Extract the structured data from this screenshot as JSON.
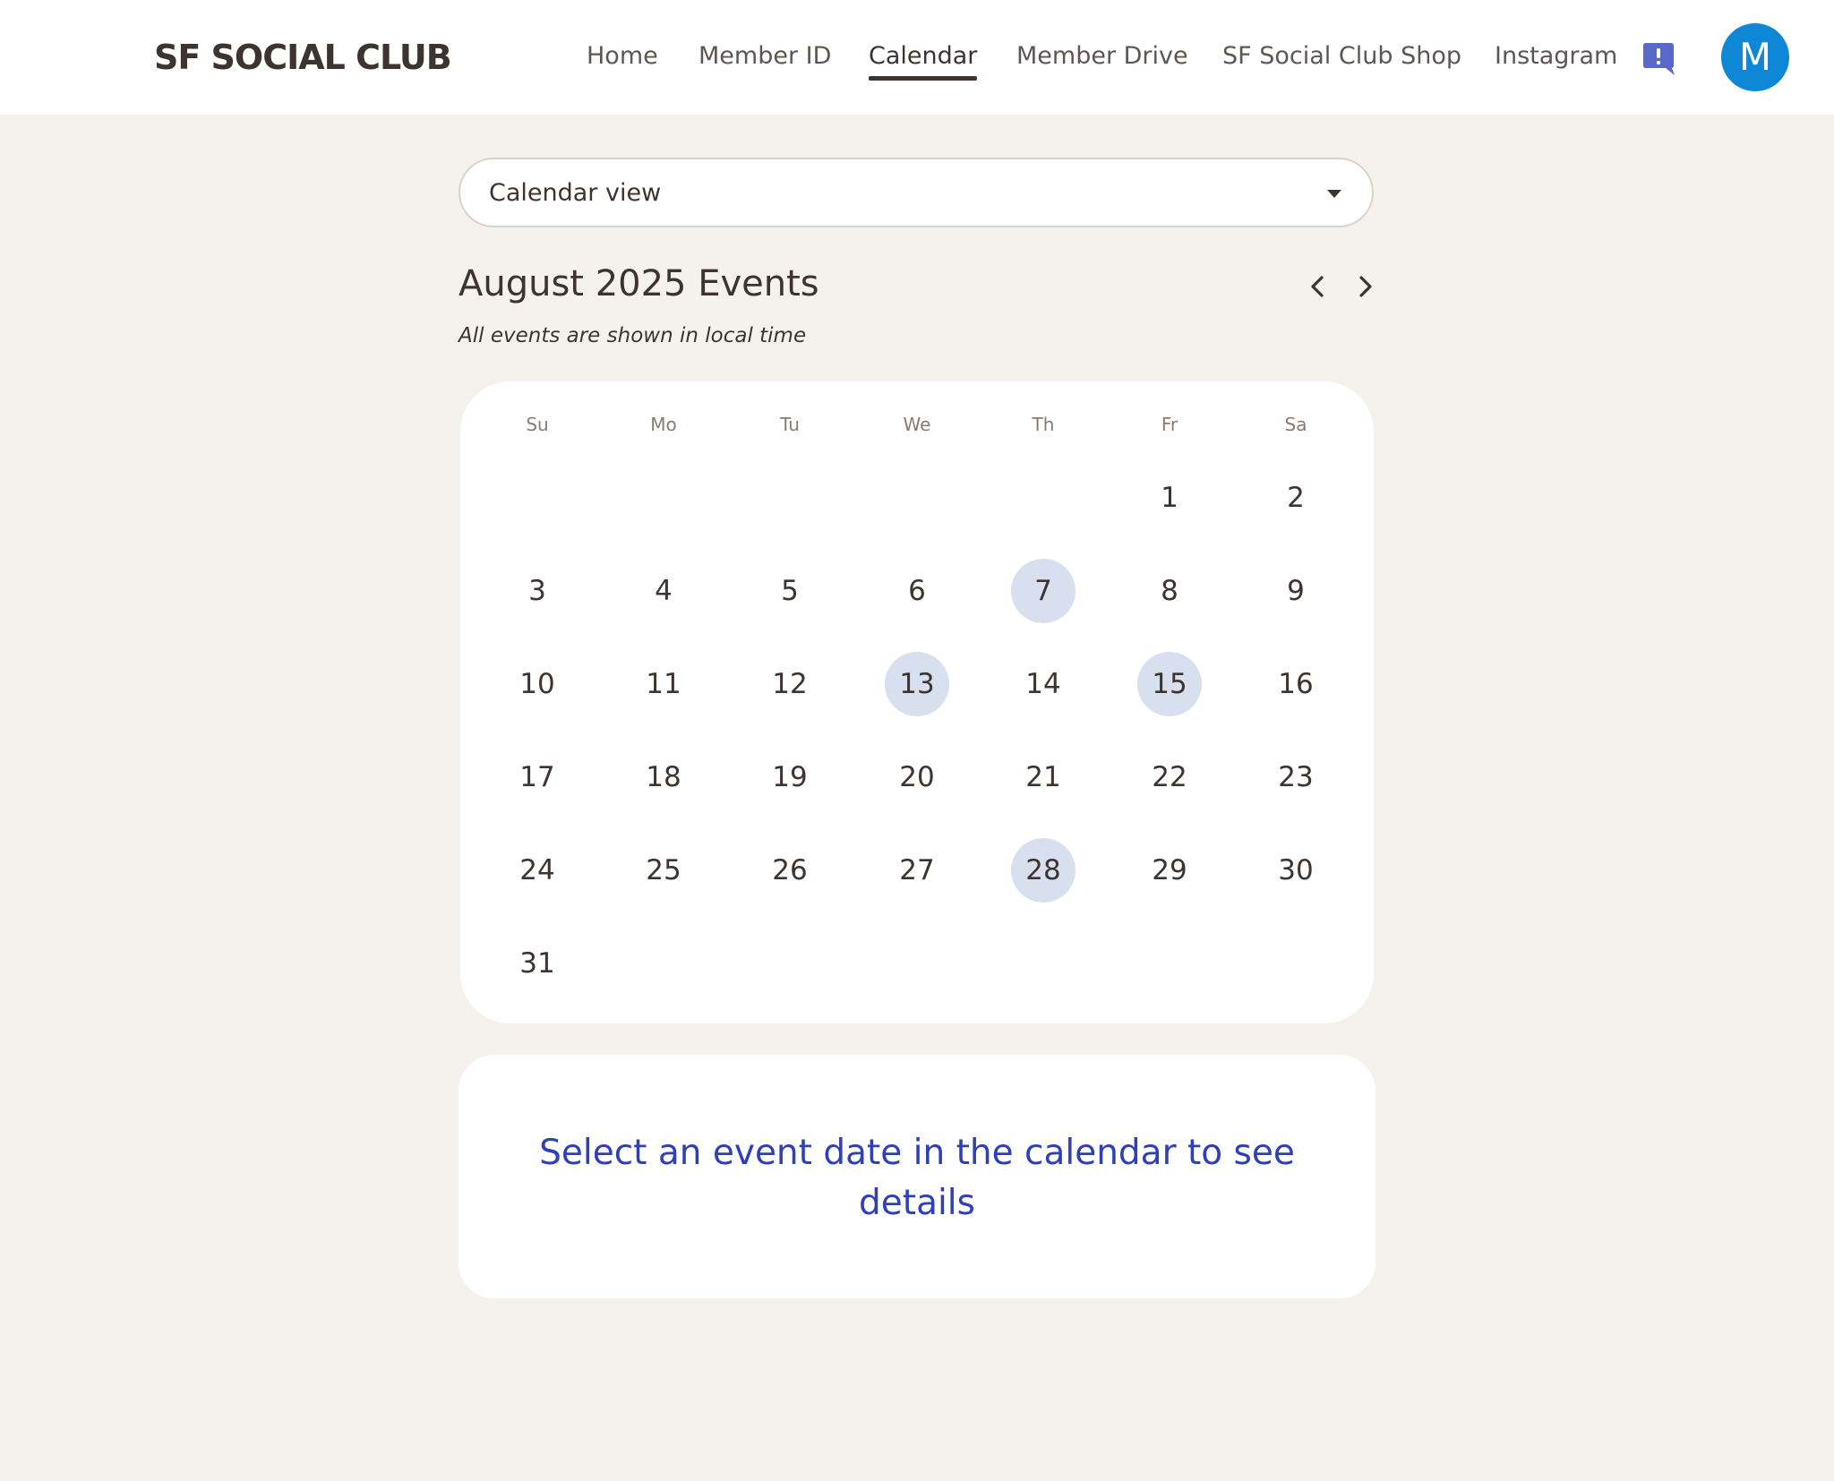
{
  "header": {
    "brand": "SF SOCIAL CLUB",
    "nav": [
      {
        "label": "Home",
        "active": false
      },
      {
        "label": "Member ID",
        "active": false
      },
      {
        "label": "Calendar",
        "active": true
      },
      {
        "label": "Member Drive",
        "active": false
      },
      {
        "label": "SF Social Club Shop",
        "active": false
      },
      {
        "label": "Instagram",
        "active": false
      }
    ],
    "feedback_icon": "feedback-exclamation-icon",
    "avatar_initial": "M",
    "avatar_color": "#0d87d6"
  },
  "view_select": {
    "value": "Calendar view"
  },
  "calendar": {
    "title": "August 2025 Events",
    "subtitle": "All events are shown in local time",
    "prev_icon": "chevron-left-icon",
    "next_icon": "chevron-right-icon",
    "weekdays": [
      "Su",
      "Mo",
      "Tu",
      "We",
      "Th",
      "Fr",
      "Sa"
    ],
    "days": [
      "1",
      "2",
      "3",
      "4",
      "5",
      "6",
      "7",
      "8",
      "9",
      "10",
      "11",
      "12",
      "13",
      "14",
      "15",
      "16",
      "17",
      "18",
      "19",
      "20",
      "21",
      "22",
      "23",
      "24",
      "25",
      "26",
      "27",
      "28",
      "29",
      "30",
      "31"
    ],
    "event_days": [
      "7",
      "13",
      "15",
      "28"
    ],
    "event_highlight_color": "#d8e0ef"
  },
  "details": {
    "message": "Select an event date in the calendar to see details",
    "message_color": "#2f3fba"
  }
}
